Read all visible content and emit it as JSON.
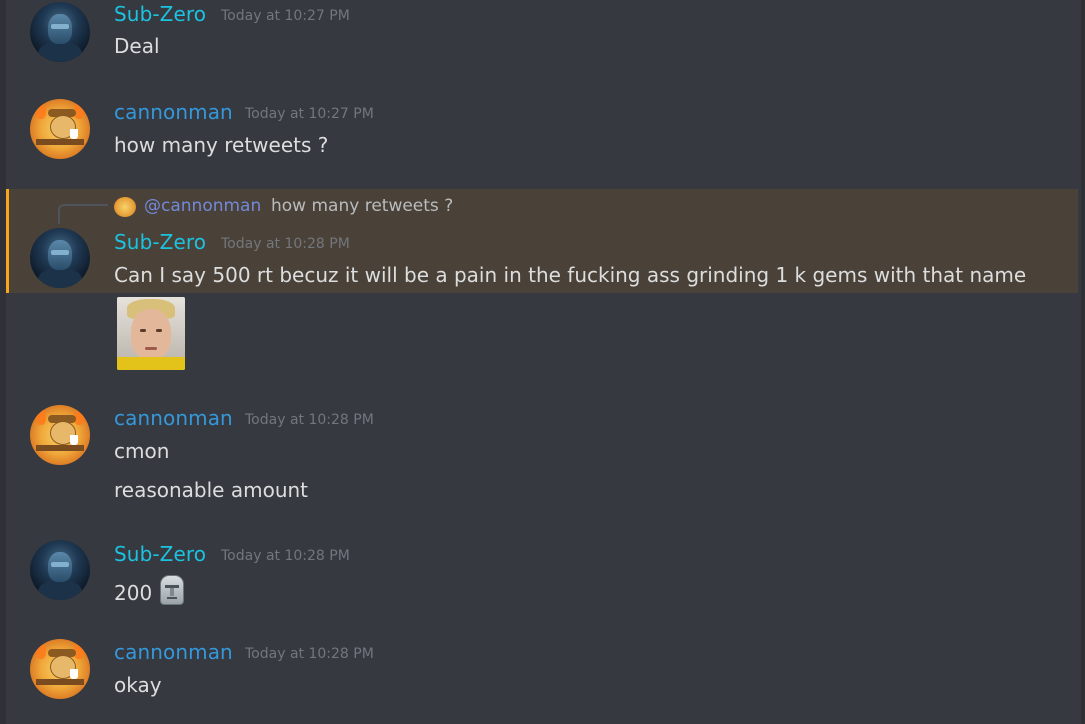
{
  "messages": [
    {
      "author": "Sub-Zero",
      "timestamp": "Today at 10:27 PM",
      "lines": [
        "Deal"
      ]
    },
    {
      "author": "cannonman",
      "timestamp": "Today at 10:27 PM",
      "lines": [
        "how many retweets ?"
      ]
    },
    {
      "author": "Sub-Zero",
      "timestamp": "Today at 10:28 PM",
      "reply": {
        "mention": "@cannonman",
        "text": "how many retweets ?"
      },
      "lines": [
        "Can I say 500 rt becuz it will be a pain in the fucking ass grinding 1 k gems with that name"
      ],
      "sticker": "face-image"
    },
    {
      "author": "cannonman",
      "timestamp": "Today at 10:28 PM",
      "lines": [
        "cmon",
        "reasonable amount"
      ]
    },
    {
      "author": "Sub-Zero",
      "timestamp": "Today at 10:28 PM",
      "lines": [
        "200"
      ],
      "emoji": "moai-icon"
    },
    {
      "author": "cannonman",
      "timestamp": "Today at 10:28 PM",
      "lines": [
        "okay"
      ]
    }
  ],
  "colors": {
    "background": "#36393f",
    "subzero_name": "#1cc3e0",
    "cannonman_name": "#3498db",
    "mention_highlight": "#4a4238",
    "mention_bar": "#faa61a",
    "timestamp": "#72767d"
  }
}
